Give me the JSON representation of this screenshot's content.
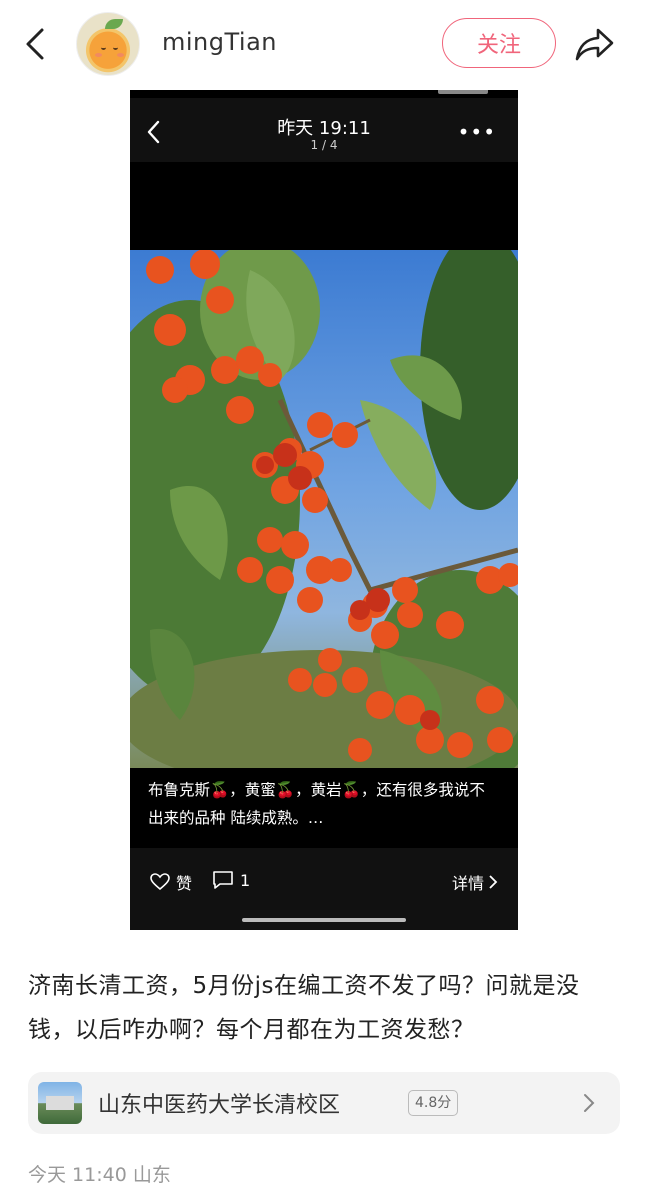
{
  "nav": {
    "username": "mingTian",
    "follow_label": "关注"
  },
  "screenshot": {
    "header_time": "昨天 19:11",
    "page_indicator": "1 / 4",
    "caption": "布鲁克斯🍒，黄蜜🍒，黄岩🍒，还有很多我说不出来的品种 陆续成熟。…",
    "like_label": "赞",
    "comment_count": "1",
    "detail_label": "详情"
  },
  "post": {
    "text": "济南长清工资，5月份js在编工资不发了吗？问就是没钱，以后咋办啊？每个月都在为工资发愁？"
  },
  "location": {
    "name": "山东中医药大学长清校区",
    "rating": "4.8分"
  },
  "meta": {
    "time_place": "今天 11:40 山东"
  },
  "colors": {
    "accent": "#f0657b",
    "meta_text": "#999999",
    "card_bg": "#f3f3f3"
  }
}
